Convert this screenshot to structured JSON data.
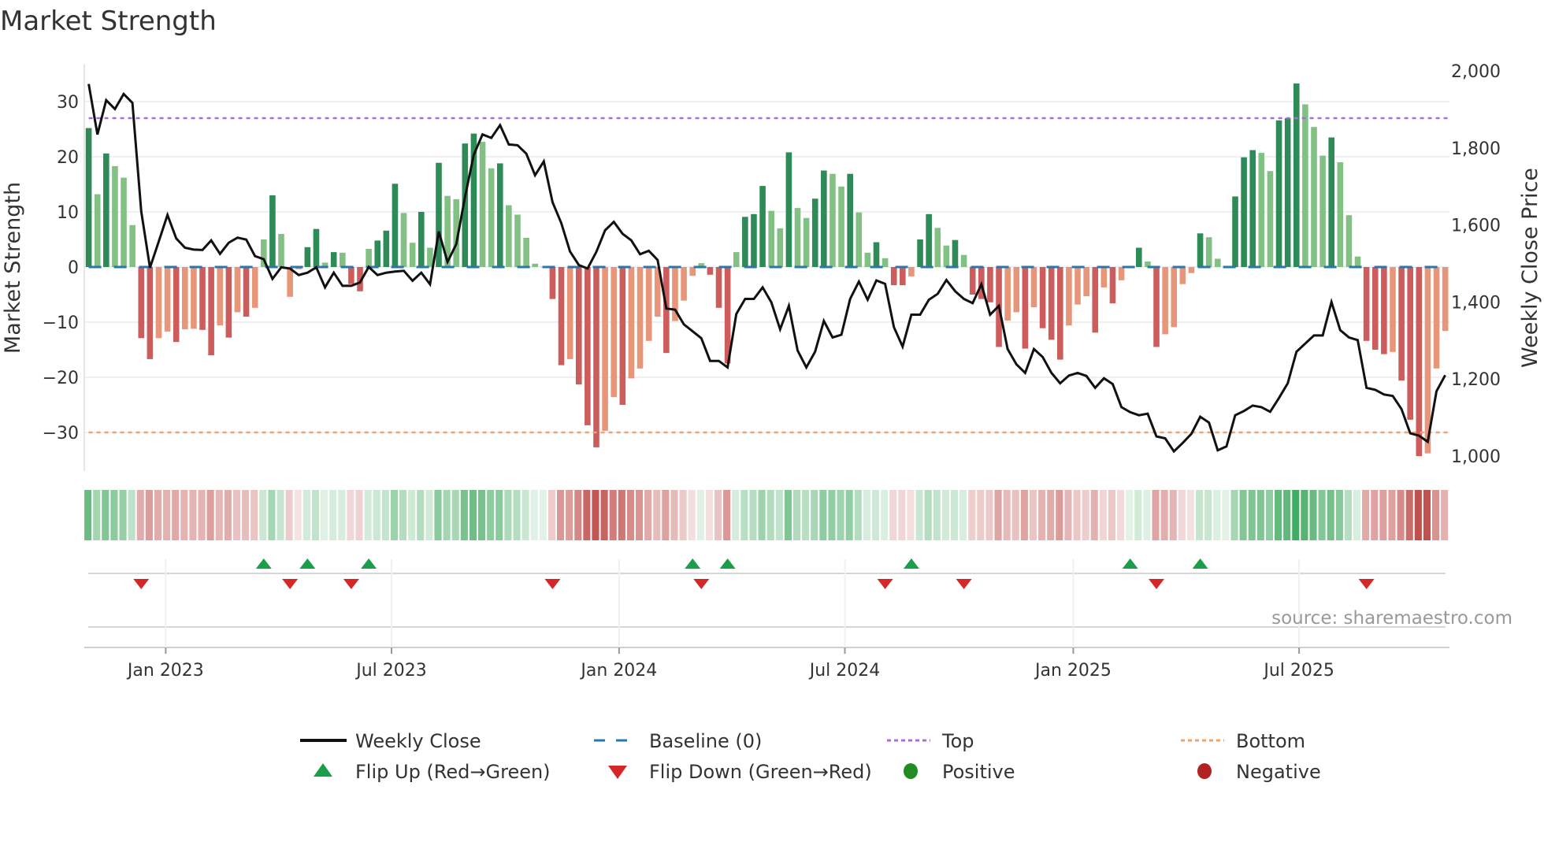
{
  "title": "Market Strength",
  "source": "source: sharemaestro.com",
  "chart_data": {
    "type": "bar+line",
    "title": "Market Strength",
    "ylabel": "Market Strength",
    "y2label": "Weekly Close Price",
    "ylim": [
      -37,
      37
    ],
    "y2lim": [
      950,
      2050
    ],
    "yticks": [
      {
        "v": 30,
        "label": "30"
      },
      {
        "v": 20,
        "label": "20"
      },
      {
        "v": 10,
        "label": "10"
      },
      {
        "v": 0,
        "label": "0"
      },
      {
        "v": -10,
        "label": "−10"
      },
      {
        "v": -20,
        "label": "−20"
      },
      {
        "v": -30,
        "label": "−30"
      }
    ],
    "y2ticks": [
      {
        "v": 2000,
        "label": "2,000"
      },
      {
        "v": 1800,
        "label": "1,800"
      },
      {
        "v": 1600,
        "label": "1,600"
      },
      {
        "v": 1400,
        "label": "1,400"
      },
      {
        "v": 1200,
        "label": "1,200"
      },
      {
        "v": 1000,
        "label": "1,000"
      }
    ],
    "xticks": [
      {
        "week": 8.8,
        "label": "Jan 2023"
      },
      {
        "week": 34.6,
        "label": "Jul 2023"
      },
      {
        "week": 60.6,
        "label": "Jan 2024"
      },
      {
        "week": 86.4,
        "label": "Jul 2024"
      },
      {
        "week": 112.5,
        "label": "Jan 2025"
      },
      {
        "week": 138.3,
        "label": "Jul 2025"
      }
    ],
    "top_level": 27,
    "bottom_level": -30,
    "baseline": 0,
    "strength": [
      25.2,
      13.2,
      20.6,
      18.3,
      16.2,
      7.6,
      -12.9,
      -16.7,
      -12.9,
      -11.7,
      -13.6,
      -11.3,
      -11.2,
      -11.4,
      -16,
      -10.6,
      -12.8,
      -8.2,
      -9,
      -7.4,
      5,
      13,
      6,
      -5.4,
      -0.4,
      3.6,
      6.9,
      0.8,
      2.7,
      2.6,
      -3.1,
      -4.4,
      3.3,
      4.8,
      6.6,
      15.1,
      9.8,
      4.4,
      10,
      3.5,
      18.9,
      12.9,
      12.3,
      22.4,
      24.2,
      22.7,
      17.9,
      18.8,
      11.2,
      9.5,
      5.3,
      0.6,
      0,
      -5.8,
      -17.8,
      -16.7,
      -21.3,
      -28.7,
      -32.7,
      -29.7,
      -23.6,
      -25,
      -20.2,
      -18.4,
      -13.4,
      -9,
      -15.6,
      -9.8,
      -6.1,
      -1.6,
      0.7,
      -1.4,
      -7.4,
      -17.5,
      2.7,
      9.1,
      9.6,
      14.7,
      10.2,
      7,
      20.8,
      10.7,
      8.9,
      12.4,
      17.5,
      16.9,
      14.6,
      16.9,
      9.9,
      2.6,
      4.5,
      1.6,
      -3.3,
      -3.3,
      -1.7,
      5,
      9.6,
      7.1,
      3.9,
      4.9,
      2.2,
      -5,
      -5.8,
      -6.4,
      -14.5,
      -9.7,
      -8.2,
      -14.8,
      -7.3,
      -11.1,
      -13.2,
      -16.8,
      -10.6,
      -6.8,
      -5.3,
      -11.9,
      -3.7,
      -6.6,
      -2.4,
      0.2,
      3.5,
      1,
      -14.5,
      -12.2,
      -10.9,
      -3.1,
      -1.1,
      6.1,
      5.4,
      1.5,
      0.2,
      12.8,
      19.9,
      21.2,
      20.7,
      17.4,
      26.6,
      27,
      33.3,
      29.5,
      25.4,
      20.2,
      23.5,
      19,
      9.4,
      1.9,
      -13.4,
      -15,
      -15.8,
      -15.4,
      -20.6,
      -27.7,
      -34.3,
      -33.8,
      -18.4,
      -11.6
    ],
    "weekly_close": [
      1966,
      1835,
      1924,
      1901,
      1940,
      1917,
      1635,
      1489,
      1557,
      1626,
      1565,
      1541,
      1536,
      1535,
      1560,
      1525,
      1554,
      1567,
      1562,
      1519,
      1511,
      1460,
      1490,
      1487,
      1470,
      1476,
      1490,
      1438,
      1476,
      1442,
      1442,
      1451,
      1491,
      1470,
      1476,
      1479,
      1481,
      1455,
      1476,
      1446,
      1583,
      1504,
      1550,
      1673,
      1782,
      1835,
      1826,
      1859,
      1809,
      1807,
      1785,
      1729,
      1765,
      1659,
      1605,
      1531,
      1496,
      1487,
      1530,
      1586,
      1608,
      1577,
      1560,
      1524,
      1533,
      1509,
      1383,
      1380,
      1342,
      1324,
      1306,
      1247,
      1247,
      1230,
      1369,
      1408,
      1408,
      1438,
      1399,
      1329,
      1390,
      1274,
      1230,
      1271,
      1351,
      1308,
      1315,
      1408,
      1453,
      1406,
      1456,
      1447,
      1335,
      1284,
      1367,
      1367,
      1406,
      1421,
      1457,
      1428,
      1408,
      1397,
      1446,
      1367,
      1390,
      1278,
      1238,
      1216,
      1278,
      1257,
      1216,
      1189,
      1209,
      1216,
      1208,
      1177,
      1202,
      1187,
      1127,
      1114,
      1106,
      1110,
      1051,
      1046,
      1012,
      1034,
      1058,
      1102,
      1087,
      1015,
      1025,
      1106,
      1117,
      1131,
      1127,
      1115,
      1151,
      1189,
      1271,
      1292,
      1313,
      1313,
      1400,
      1327,
      1308,
      1301,
      1177,
      1172,
      1160,
      1156,
      1122,
      1059,
      1053,
      1037,
      1168,
      1210
    ],
    "flip_up_weeks": [
      20,
      25,
      32,
      69,
      73,
      94,
      119,
      127
    ],
    "flip_down_weeks": [
      6,
      23,
      30,
      53,
      70,
      91,
      100,
      122,
      146
    ],
    "legend": {
      "weekly_close": "Weekly Close",
      "baseline": "Baseline (0)",
      "top": "Top",
      "bottom": "Bottom",
      "flip_up": "Flip Up (Red→Green)",
      "flip_down": "Flip Down (Green→Red)",
      "positive": "Positive",
      "negative": "Negative"
    },
    "legend_placement": "bottom"
  },
  "colors": {
    "green_strong": "#2e8b57",
    "green_weak": "#82c083",
    "red_strong": "#cd5c5c",
    "red_weak": "#e8967a",
    "line": "#111111",
    "baseline": "#2a77a8",
    "top": "#a86fdc",
    "bottom": "#f0a36a",
    "flip_up": "#1a9e4a",
    "flip_down": "#d62728",
    "positive": "#228b22",
    "negative": "#b22222"
  }
}
